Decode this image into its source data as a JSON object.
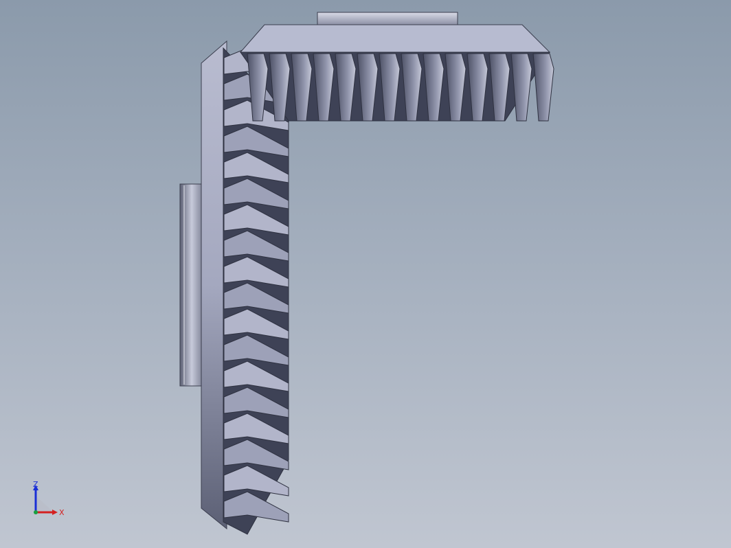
{
  "viewport": {
    "background_top": "#8b9aab",
    "background_bottom": "#c0c6d1"
  },
  "model": {
    "description_icon": "bevel-gear-pair",
    "gear_color": "#9a9fb5",
    "gear_dark": "#4a4e62",
    "gear_light": "#c9ccdc"
  },
  "triad": {
    "z_label": "Z",
    "x_label": "X",
    "z_color": "#1a2fd6",
    "x_color": "#d42020",
    "origin_color": "#18a040"
  }
}
